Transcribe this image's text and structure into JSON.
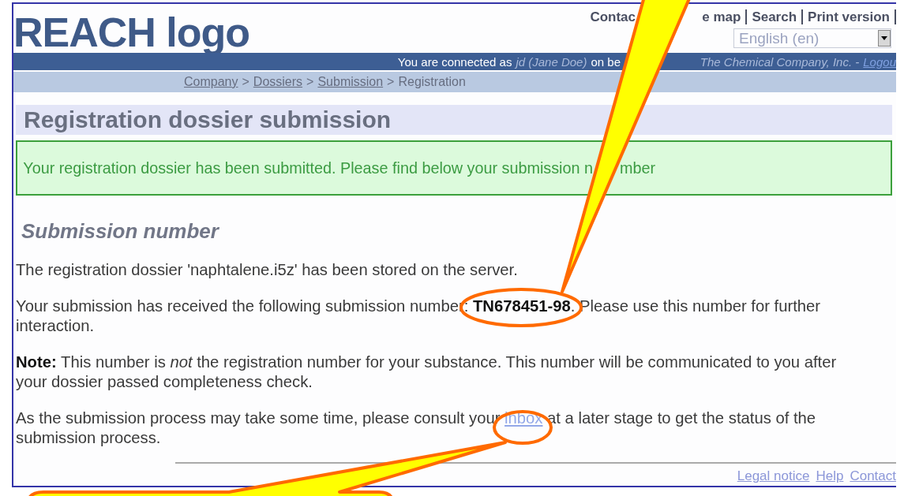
{
  "header": {
    "logo": "REACH logo",
    "links": [
      "Contac",
      "e map",
      "Search",
      "Print version"
    ],
    "language": "English (en)"
  },
  "user_bar": {
    "prefix": "You are connected as",
    "user": "jd (Jane Doe)",
    "middle": "on be",
    "company": "The Chemical Company, Inc. -",
    "logout": "Logou"
  },
  "breadcrumb": [
    {
      "label": "Company",
      "link": true
    },
    {
      "label": ">",
      "link": false
    },
    {
      "label": "Dossiers",
      "link": true
    },
    {
      "label": ">",
      "link": false
    },
    {
      "label": "Submission",
      "link": true
    },
    {
      "label": ">",
      "link": false
    },
    {
      "label": "Registration",
      "link": false
    }
  ],
  "page_title": "Registration dossier submission",
  "success_message": [
    "Your registration dossier has been submitted. Please find below your submission n",
    "mber"
  ],
  "section_title": "Submission number",
  "paragraphs": [
    {
      "text": "The registration dossier 'naphtalene.i5z' has been stored on the server."
    },
    {
      "text": "Your submission has received the following submission number: **TN678451-98**. Please use this number for further interaction."
    },
    {
      "text": "**Note:** This number is *not* the registration number for your substance. This number will be communicated to you after your dossier passed completeness check."
    },
    {
      "text": "As the submission process may take some time, please consult your",
      "link": "inbox",
      "after": "at a later stage to get the status of the submission process."
    }
  ],
  "footer_links": [
    "Legal notice",
    "Help",
    "Contact"
  ]
}
